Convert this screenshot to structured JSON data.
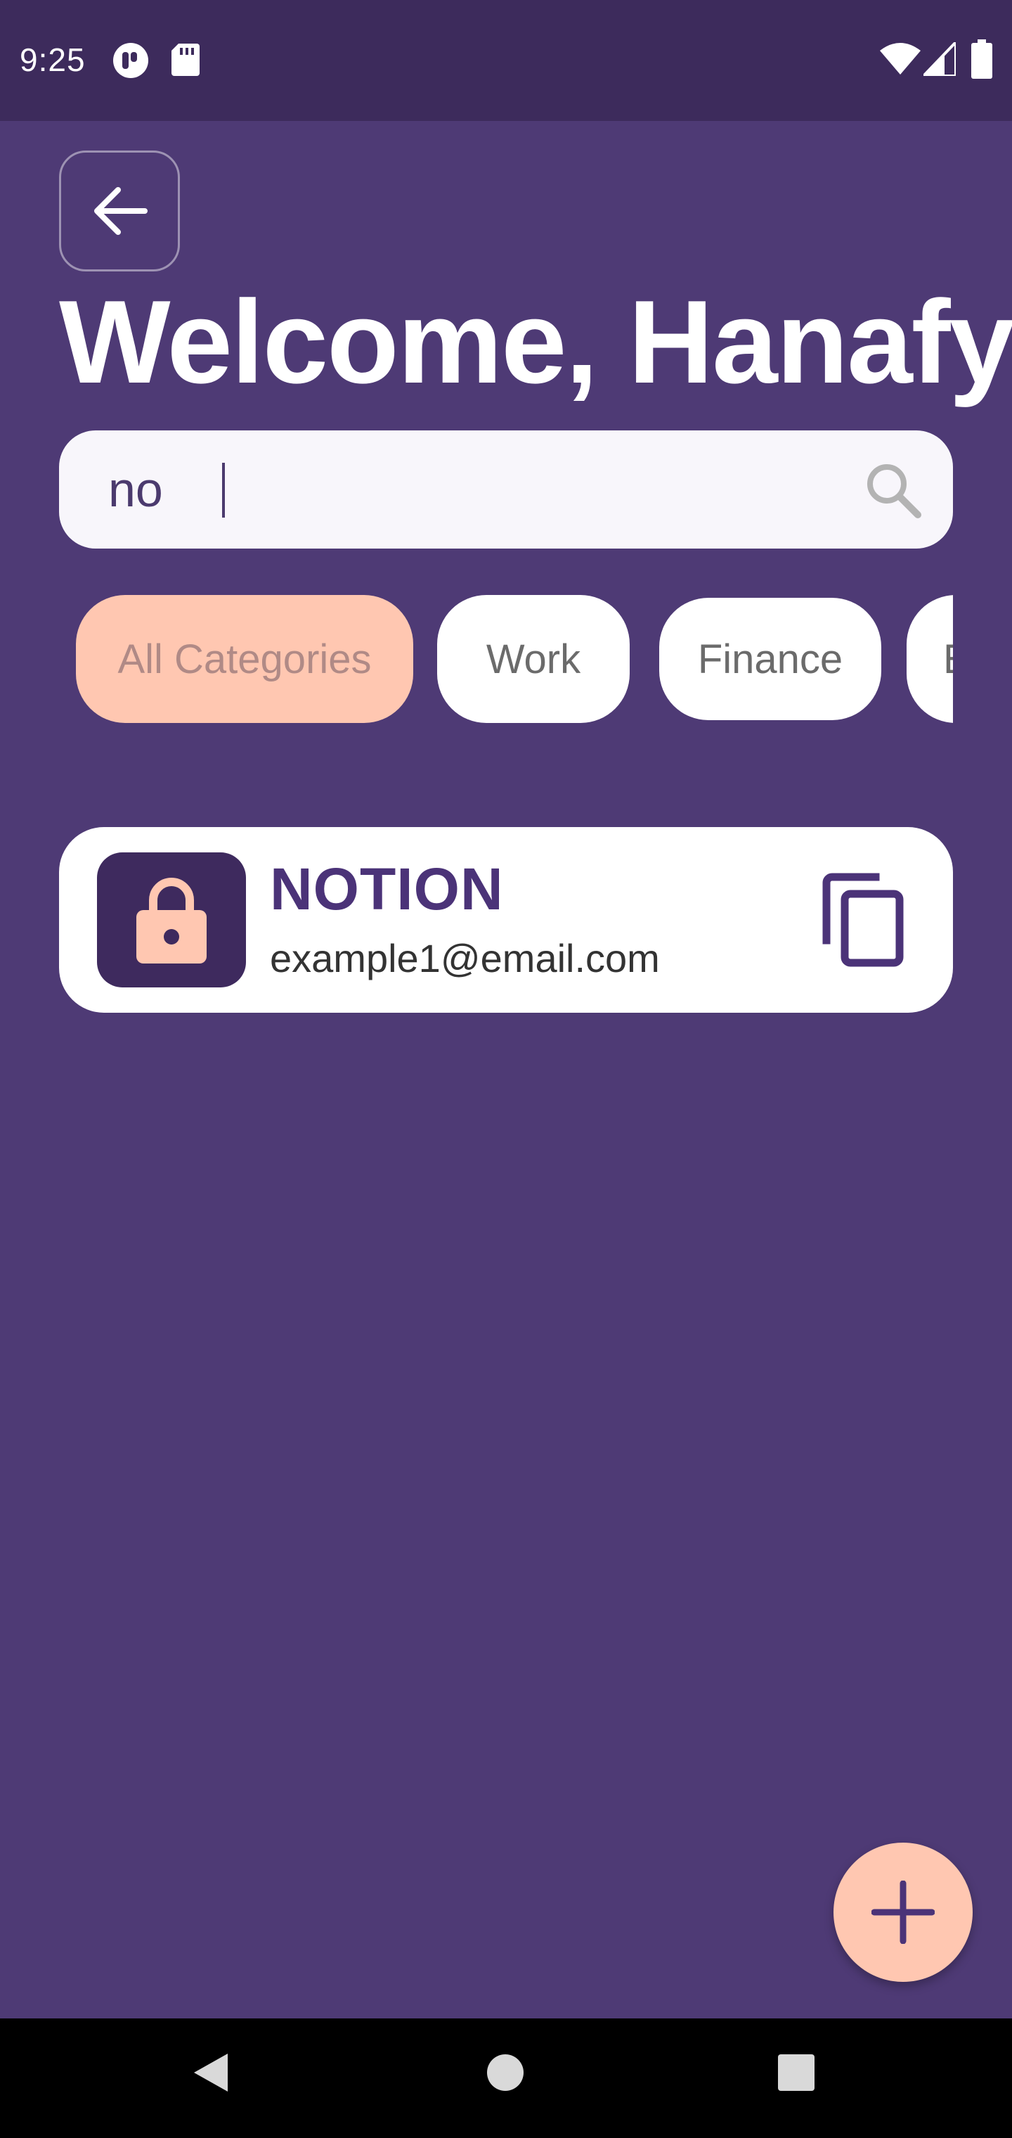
{
  "status_bar": {
    "time": "9:25",
    "icons": [
      "notification-app-icon",
      "sd-card-icon",
      "wifi-icon",
      "signal-icon",
      "battery-icon"
    ]
  },
  "header": {
    "back_icon": "arrow-back-icon",
    "title": "Welcome, Hanafy"
  },
  "search": {
    "value": "no",
    "icon": "search-icon"
  },
  "categories": {
    "items": [
      {
        "label": "All Categories",
        "active": true
      },
      {
        "label": "Work",
        "active": false
      },
      {
        "label": "Finance",
        "active": false
      },
      {
        "label": "E",
        "active": false
      }
    ]
  },
  "entries": [
    {
      "title": "NOTION",
      "email": "example1@email.com",
      "icon": "lock-icon",
      "action_icon": "copy-icon"
    }
  ],
  "fab": {
    "icon": "add-icon"
  },
  "nav_bar": {
    "icons": [
      "back-triangle-icon",
      "home-circle-icon",
      "recents-square-icon"
    ]
  },
  "colors": {
    "background": "#4e3a75",
    "status_bar": "#3d2b5c",
    "accent": "#ffc7b1",
    "card_icon_bg": "#3e2a5e",
    "title_text": "#4b3378"
  }
}
